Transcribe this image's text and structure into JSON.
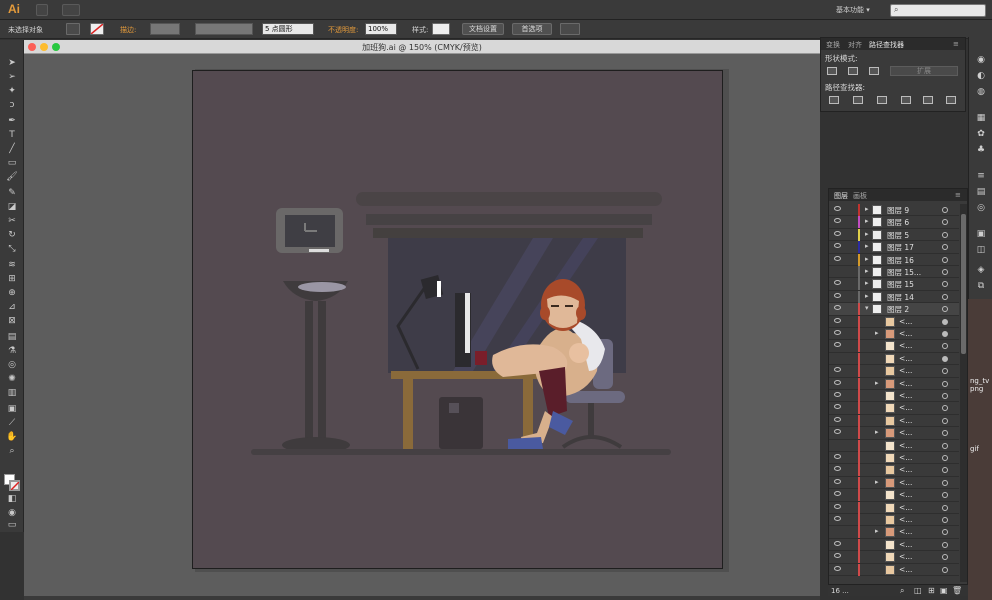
{
  "menubar": {
    "app_logo": "Ai",
    "workspace": "基本功能",
    "workspace_chevron": "▾"
  },
  "controlbar": {
    "selection_label": "未选择对象",
    "stroke_label": "描边:",
    "brush_value": "5 点圆形",
    "opacity_label": "不透明度:",
    "opacity_value": "100%",
    "style_label": "样式:",
    "doc_setup_button": "文档设置",
    "preferences_button": "首选项"
  },
  "document": {
    "title": "加班狗.ai @ 150% (CMYK/预览)"
  },
  "pathfinder_panel": {
    "tabs": [
      "变换",
      "对齐",
      "路径查找器"
    ],
    "shape_modes_label": "形状模式:",
    "pathfinder_label": "路径查找器:",
    "expand_button": "扩展"
  },
  "layers_panel": {
    "tabs": [
      "图层",
      "画板"
    ],
    "footer_count": "16 ...",
    "layers": [
      {
        "name": "图层 9",
        "color": "#c0332f",
        "expandable": true
      },
      {
        "name": "图层 6",
        "color": "#c14dc0",
        "expandable": true
      },
      {
        "name": "图层 5",
        "color": "#e0d04a",
        "expandable": true
      },
      {
        "name": "图层 17",
        "color": "#2c2ca0",
        "expandable": true
      },
      {
        "name": "图层 16",
        "color": "#d49a2a",
        "expandable": true
      },
      {
        "name": "图层 15...",
        "color": "#6a6a6a",
        "expandable": true
      },
      {
        "name": "图层 15",
        "color": "#6a6a6a",
        "expandable": true
      },
      {
        "name": "图层 14",
        "color": "#6a6a6a",
        "expandable": true
      },
      {
        "name": "图层 2",
        "color": "#d04a4a",
        "expandable": true
      }
    ],
    "sublayer_label": "<..."
  },
  "desktop": {
    "file1_line1": "ng_tv",
    "file1_line2": "png",
    "file2": "gif"
  }
}
